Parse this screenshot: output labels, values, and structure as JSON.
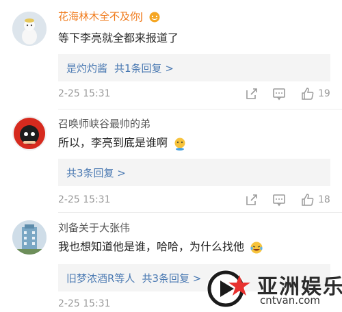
{
  "comments": [
    {
      "username": "花海林木全不及你J",
      "content": "等下李亮就全都来报道了",
      "reply_user": "是灼灼酱",
      "reply_count": "共1条回复 >",
      "time": "2-25 15:31",
      "likes": "19",
      "avatar_icon": "white-cat-avatar-icon",
      "username_badge_icon": "orange-emoji-badge-icon"
    },
    {
      "username": "召唤师峡谷最帅的弟",
      "content": "所以，李亮到底是谁啊",
      "reply_count": "共3条回复 >",
      "time": "2-25 15:31",
      "likes": "18",
      "avatar_icon": "red-hood-avatar-icon",
      "content_emoji": "thinking-emoji-icon"
    },
    {
      "username": "刘备关于大张伟",
      "content": "我也想知道他是谁，哈哈，为什么找他",
      "reply_user": "旧梦浓酒R等人",
      "reply_count": "共3条回复 >",
      "time": "2-25 15:31",
      "avatar_icon": "building-avatar-icon",
      "content_emoji": "laughing-tears-emoji-icon"
    }
  ],
  "actions": {
    "share_icon": "share-icon",
    "comment_icon": "comment-icon",
    "like_icon": "thumbs-up-icon"
  },
  "watermark": {
    "text": "亚洲娱乐",
    "url": "cntvan.com",
    "logo_icon": "play-star-logo-icon"
  },
  "colors": {
    "username_vip": "#f07b1c",
    "link": "#4a79b2",
    "muted": "#999999",
    "reply_bg": "#f4f4f4",
    "logo_red": "#e8312f"
  }
}
